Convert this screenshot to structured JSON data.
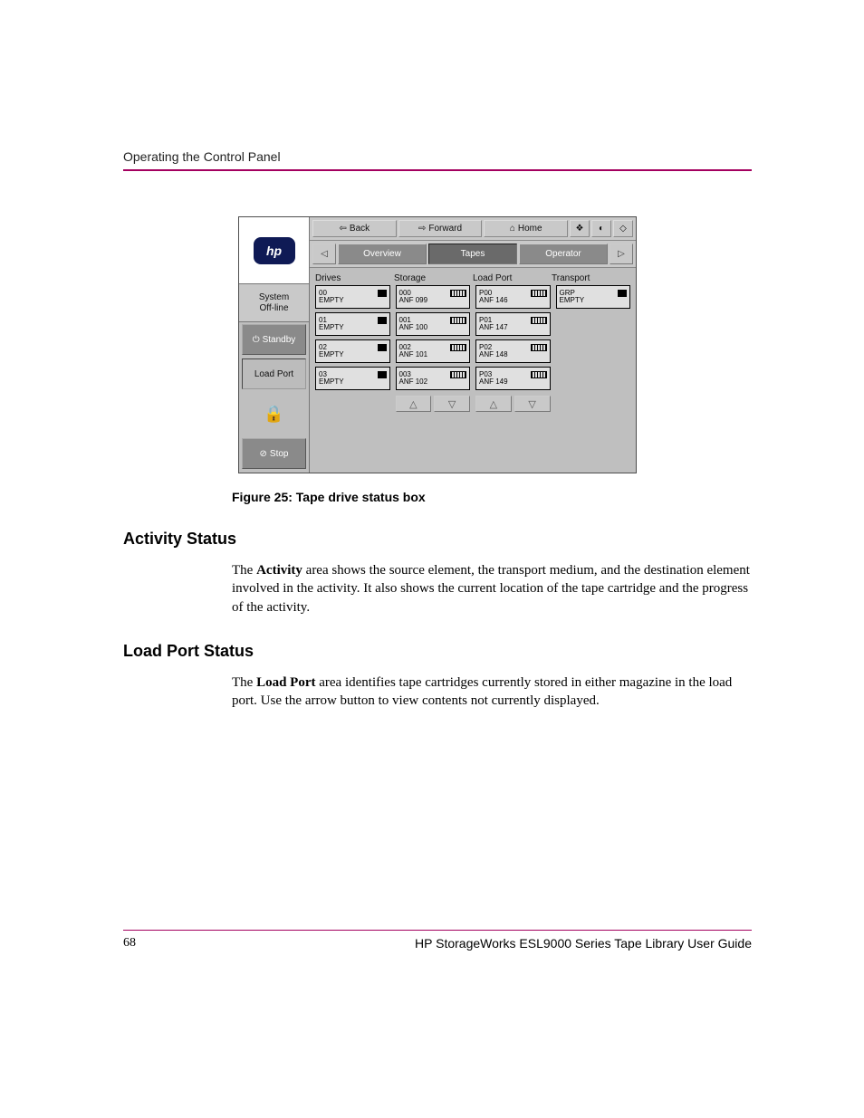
{
  "running_head": "Operating the Control Panel",
  "figure": {
    "caption": "Figure 25:  Tape drive status box"
  },
  "gui": {
    "logo_text": "hp",
    "side": {
      "system_status": "System\nOff-line",
      "standby_label": "Standby",
      "loadport_label": "Load Port",
      "stop_label": "Stop"
    },
    "toolbar": {
      "back": "Back",
      "forward": "Forward",
      "home": "Home"
    },
    "subtabs": {
      "overview": "Overview",
      "tapes": "Tapes",
      "operator": "Operator"
    },
    "headers": {
      "drives": "Drives",
      "storage": "Storage",
      "load_port": "Load Port",
      "transport": "Transport"
    },
    "drives": [
      {
        "id": "00",
        "state": "EMPTY"
      },
      {
        "id": "01",
        "state": "EMPTY"
      },
      {
        "id": "02",
        "state": "EMPTY"
      },
      {
        "id": "03",
        "state": "EMPTY"
      }
    ],
    "storage": [
      {
        "id": "000",
        "label": "ANF 099"
      },
      {
        "id": "001",
        "label": "ANF 100"
      },
      {
        "id": "002",
        "label": "ANF 101"
      },
      {
        "id": "003",
        "label": "ANF 102"
      }
    ],
    "loadport": [
      {
        "id": "P00",
        "label": "ANF 146"
      },
      {
        "id": "P01",
        "label": "ANF 147"
      },
      {
        "id": "P02",
        "label": "ANF 148"
      },
      {
        "id": "P03",
        "label": "ANF 149"
      }
    ],
    "transport": [
      {
        "id": "GRP",
        "state": "EMPTY"
      }
    ]
  },
  "sections": {
    "activity": {
      "heading": "Activity Status",
      "para_pre": "The ",
      "para_bold": "Activity",
      "para_post": " area shows the source element, the transport medium, and the destination element involved in the activity. It also shows the current location of the tape cartridge and the progress of the activity."
    },
    "loadport": {
      "heading": "Load Port Status",
      "para_pre": "The ",
      "para_bold": "Load Port",
      "para_post": " area identifies tape cartridges currently stored in either magazine in the load port. Use the arrow button to view contents not currently displayed."
    }
  },
  "footer": {
    "page": "68",
    "guide": "HP StorageWorks ESL9000 Series Tape Library User Guide"
  }
}
